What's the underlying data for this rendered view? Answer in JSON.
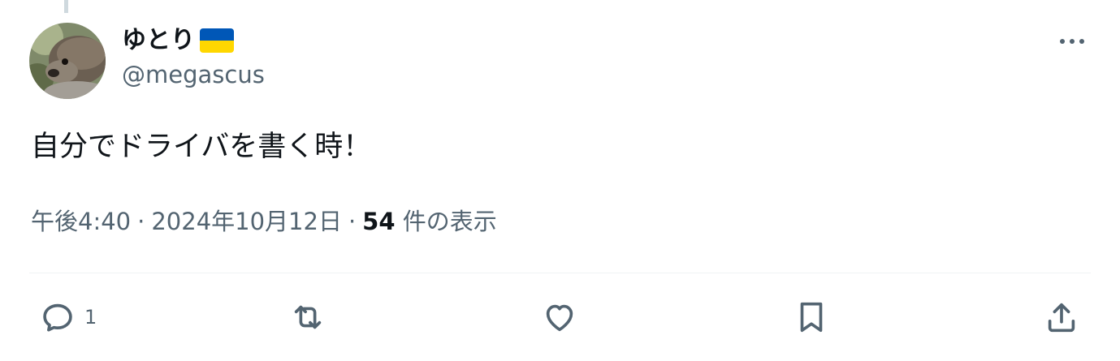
{
  "author": {
    "display_name": "ゆとり",
    "handle": "@megascus",
    "flag_icon": "ukraine-flag-icon",
    "avatar": "hedgehog-photo"
  },
  "tweet": {
    "text": "自分でドライバを書く時！"
  },
  "meta": {
    "time": "午後4:40",
    "separator": "·",
    "date": "2024年10月12日",
    "views_count": "54",
    "views_label": "件の表示"
  },
  "actions": {
    "reply_count": "1",
    "icons": [
      "reply-icon",
      "retweet-icon",
      "like-icon",
      "bookmark-icon",
      "share-icon"
    ]
  },
  "colors": {
    "primary_text": "#0f1419",
    "secondary_text": "#536471",
    "divider": "#eff3f4",
    "flag_blue": "#0057b7",
    "flag_yellow": "#ffd700"
  }
}
